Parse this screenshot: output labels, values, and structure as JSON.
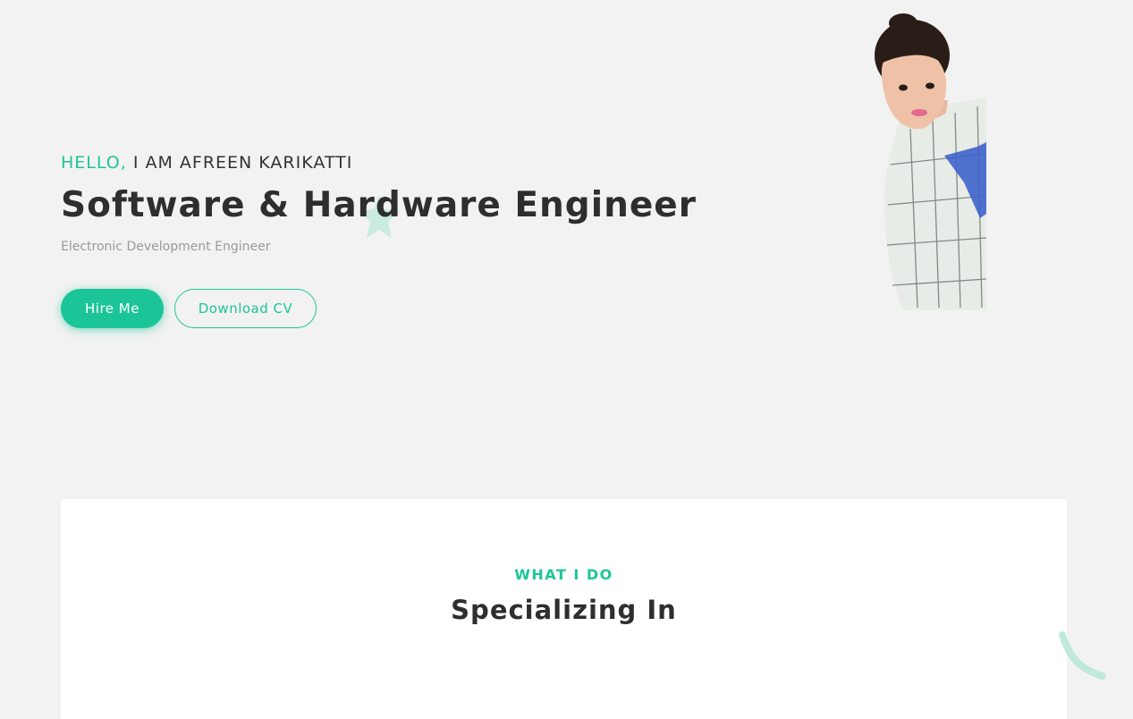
{
  "hero": {
    "greeting_accent": "HELLO,",
    "greeting_rest": "I AM AFREEN KARIKATTI",
    "title": "Software & Hardware Engineer",
    "subtitle": "Electronic Development Engineer",
    "hire_button": "Hire Me",
    "download_button": "Download CV"
  },
  "services": {
    "eyebrow": "WHAT I DO",
    "heading": "Specializing In"
  },
  "colors": {
    "accent": "#1cc597",
    "background": "#f2f2f2",
    "card": "#ffffff",
    "text": "#2e2e2e",
    "muted": "#9a9a9a"
  },
  "icons": {
    "decoration_1": "star-shape",
    "decoration_2": "swoosh-shape"
  }
}
